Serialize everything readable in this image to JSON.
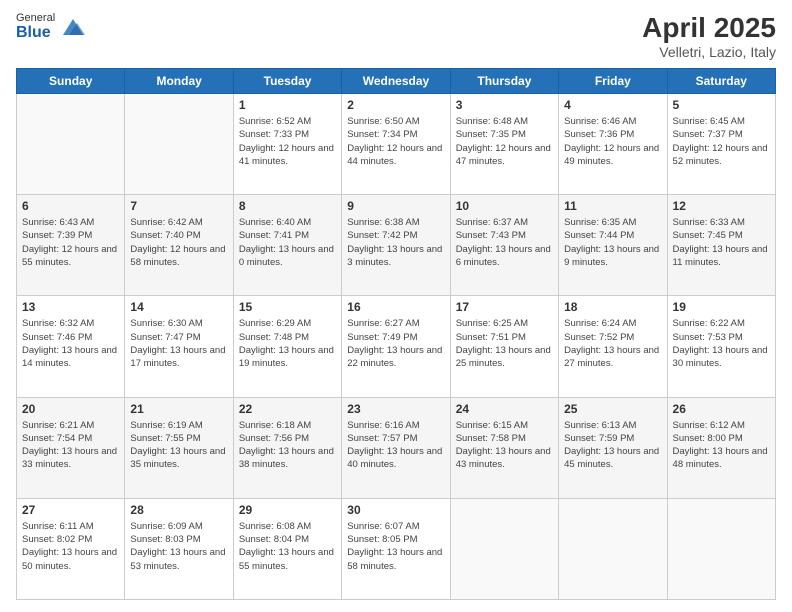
{
  "header": {
    "logo_general": "General",
    "logo_blue": "Blue",
    "title": "April 2025",
    "subtitle": "Velletri, Lazio, Italy"
  },
  "weekdays": [
    "Sunday",
    "Monday",
    "Tuesday",
    "Wednesday",
    "Thursday",
    "Friday",
    "Saturday"
  ],
  "weeks": [
    [
      {
        "day": "",
        "empty": true
      },
      {
        "day": "",
        "empty": true
      },
      {
        "day": "1",
        "sunrise": "Sunrise: 6:52 AM",
        "sunset": "Sunset: 7:33 PM",
        "daylight": "Daylight: 12 hours and 41 minutes."
      },
      {
        "day": "2",
        "sunrise": "Sunrise: 6:50 AM",
        "sunset": "Sunset: 7:34 PM",
        "daylight": "Daylight: 12 hours and 44 minutes."
      },
      {
        "day": "3",
        "sunrise": "Sunrise: 6:48 AM",
        "sunset": "Sunset: 7:35 PM",
        "daylight": "Daylight: 12 hours and 47 minutes."
      },
      {
        "day": "4",
        "sunrise": "Sunrise: 6:46 AM",
        "sunset": "Sunset: 7:36 PM",
        "daylight": "Daylight: 12 hours and 49 minutes."
      },
      {
        "day": "5",
        "sunrise": "Sunrise: 6:45 AM",
        "sunset": "Sunset: 7:37 PM",
        "daylight": "Daylight: 12 hours and 52 minutes."
      }
    ],
    [
      {
        "day": "6",
        "sunrise": "Sunrise: 6:43 AM",
        "sunset": "Sunset: 7:39 PM",
        "daylight": "Daylight: 12 hours and 55 minutes."
      },
      {
        "day": "7",
        "sunrise": "Sunrise: 6:42 AM",
        "sunset": "Sunset: 7:40 PM",
        "daylight": "Daylight: 12 hours and 58 minutes."
      },
      {
        "day": "8",
        "sunrise": "Sunrise: 6:40 AM",
        "sunset": "Sunset: 7:41 PM",
        "daylight": "Daylight: 13 hours and 0 minutes."
      },
      {
        "day": "9",
        "sunrise": "Sunrise: 6:38 AM",
        "sunset": "Sunset: 7:42 PM",
        "daylight": "Daylight: 13 hours and 3 minutes."
      },
      {
        "day": "10",
        "sunrise": "Sunrise: 6:37 AM",
        "sunset": "Sunset: 7:43 PM",
        "daylight": "Daylight: 13 hours and 6 minutes."
      },
      {
        "day": "11",
        "sunrise": "Sunrise: 6:35 AM",
        "sunset": "Sunset: 7:44 PM",
        "daylight": "Daylight: 13 hours and 9 minutes."
      },
      {
        "day": "12",
        "sunrise": "Sunrise: 6:33 AM",
        "sunset": "Sunset: 7:45 PM",
        "daylight": "Daylight: 13 hours and 11 minutes."
      }
    ],
    [
      {
        "day": "13",
        "sunrise": "Sunrise: 6:32 AM",
        "sunset": "Sunset: 7:46 PM",
        "daylight": "Daylight: 13 hours and 14 minutes."
      },
      {
        "day": "14",
        "sunrise": "Sunrise: 6:30 AM",
        "sunset": "Sunset: 7:47 PM",
        "daylight": "Daylight: 13 hours and 17 minutes."
      },
      {
        "day": "15",
        "sunrise": "Sunrise: 6:29 AM",
        "sunset": "Sunset: 7:48 PM",
        "daylight": "Daylight: 13 hours and 19 minutes."
      },
      {
        "day": "16",
        "sunrise": "Sunrise: 6:27 AM",
        "sunset": "Sunset: 7:49 PM",
        "daylight": "Daylight: 13 hours and 22 minutes."
      },
      {
        "day": "17",
        "sunrise": "Sunrise: 6:25 AM",
        "sunset": "Sunset: 7:51 PM",
        "daylight": "Daylight: 13 hours and 25 minutes."
      },
      {
        "day": "18",
        "sunrise": "Sunrise: 6:24 AM",
        "sunset": "Sunset: 7:52 PM",
        "daylight": "Daylight: 13 hours and 27 minutes."
      },
      {
        "day": "19",
        "sunrise": "Sunrise: 6:22 AM",
        "sunset": "Sunset: 7:53 PM",
        "daylight": "Daylight: 13 hours and 30 minutes."
      }
    ],
    [
      {
        "day": "20",
        "sunrise": "Sunrise: 6:21 AM",
        "sunset": "Sunset: 7:54 PM",
        "daylight": "Daylight: 13 hours and 33 minutes."
      },
      {
        "day": "21",
        "sunrise": "Sunrise: 6:19 AM",
        "sunset": "Sunset: 7:55 PM",
        "daylight": "Daylight: 13 hours and 35 minutes."
      },
      {
        "day": "22",
        "sunrise": "Sunrise: 6:18 AM",
        "sunset": "Sunset: 7:56 PM",
        "daylight": "Daylight: 13 hours and 38 minutes."
      },
      {
        "day": "23",
        "sunrise": "Sunrise: 6:16 AM",
        "sunset": "Sunset: 7:57 PM",
        "daylight": "Daylight: 13 hours and 40 minutes."
      },
      {
        "day": "24",
        "sunrise": "Sunrise: 6:15 AM",
        "sunset": "Sunset: 7:58 PM",
        "daylight": "Daylight: 13 hours and 43 minutes."
      },
      {
        "day": "25",
        "sunrise": "Sunrise: 6:13 AM",
        "sunset": "Sunset: 7:59 PM",
        "daylight": "Daylight: 13 hours and 45 minutes."
      },
      {
        "day": "26",
        "sunrise": "Sunrise: 6:12 AM",
        "sunset": "Sunset: 8:00 PM",
        "daylight": "Daylight: 13 hours and 48 minutes."
      }
    ],
    [
      {
        "day": "27",
        "sunrise": "Sunrise: 6:11 AM",
        "sunset": "Sunset: 8:02 PM",
        "daylight": "Daylight: 13 hours and 50 minutes."
      },
      {
        "day": "28",
        "sunrise": "Sunrise: 6:09 AM",
        "sunset": "Sunset: 8:03 PM",
        "daylight": "Daylight: 13 hours and 53 minutes."
      },
      {
        "day": "29",
        "sunrise": "Sunrise: 6:08 AM",
        "sunset": "Sunset: 8:04 PM",
        "daylight": "Daylight: 13 hours and 55 minutes."
      },
      {
        "day": "30",
        "sunrise": "Sunrise: 6:07 AM",
        "sunset": "Sunset: 8:05 PM",
        "daylight": "Daylight: 13 hours and 58 minutes."
      },
      {
        "day": "",
        "empty": true
      },
      {
        "day": "",
        "empty": true
      },
      {
        "day": "",
        "empty": true
      }
    ]
  ]
}
